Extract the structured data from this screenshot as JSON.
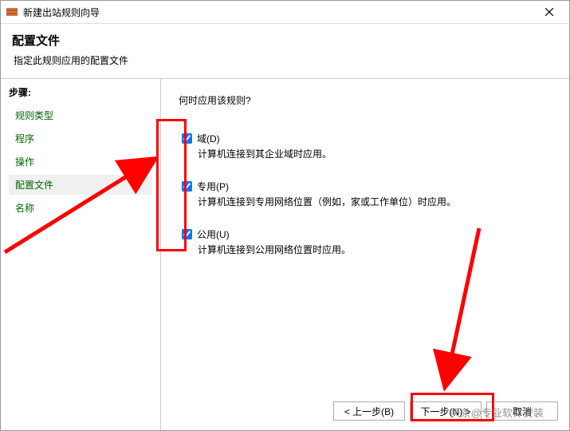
{
  "window": {
    "title": "新建出站规则向导"
  },
  "header": {
    "title": "配置文件",
    "subtitle": "指定此规则应用的配置文件"
  },
  "sidebar": {
    "steps_label": "步骤:",
    "items": [
      {
        "label": "规则类型",
        "current": false
      },
      {
        "label": "程序",
        "current": false
      },
      {
        "label": "操作",
        "current": false
      },
      {
        "label": "配置文件",
        "current": true
      },
      {
        "label": "名称",
        "current": false
      }
    ]
  },
  "content": {
    "question": "何时应用该规则?",
    "profiles": [
      {
        "label": "域(D)",
        "desc": "计算机连接到其企业域时应用。",
        "checked": true
      },
      {
        "label": "专用(P)",
        "desc": "计算机连接到专用网络位置（例如，家或工作单位）时应用。",
        "checked": true
      },
      {
        "label": "公用(U)",
        "desc": "计算机连接到公用网络位置时应用。",
        "checked": true
      }
    ]
  },
  "buttons": {
    "back": "< 上一步(B)",
    "next": "下一步(N) >",
    "cancel": "取消"
  },
  "watermark": "头条@专业软件安装"
}
